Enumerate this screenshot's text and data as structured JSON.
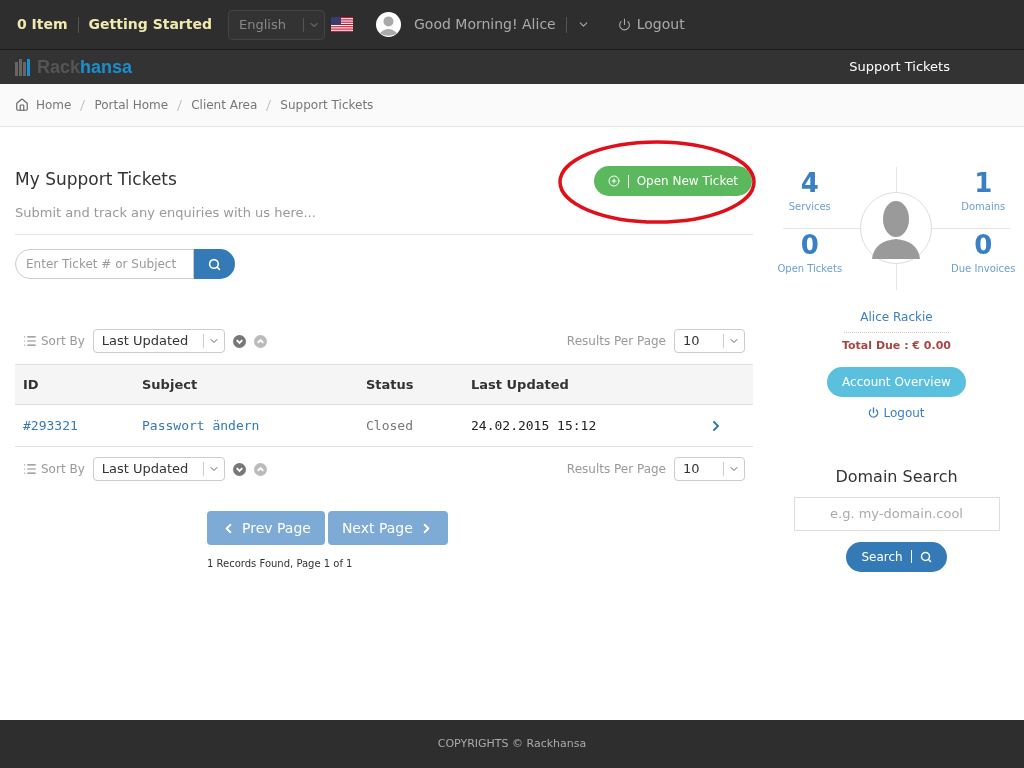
{
  "top_bar": {
    "cart": "0 Item",
    "getting_started": "Getting Started",
    "language": "English",
    "greeting": "Good Morning! Alice",
    "logout": "Logout"
  },
  "nav": {
    "logo_left": "Rack",
    "logo_right": "hansa",
    "active_item": "Support Tickets"
  },
  "breadcrumb": [
    "Home",
    "Portal Home",
    "Client Area",
    "Support Tickets"
  ],
  "page": {
    "title": "My Support Tickets",
    "subtitle": "Submit and track any enquiries with us here...",
    "open_button": "Open New Ticket",
    "search_placeholder": "Enter Ticket # or Subject"
  },
  "sort_bars": [
    {
      "sort_label": "Sort By",
      "sort_value": "Last Updated",
      "per_page_label": "Results Per Page",
      "per_page_value": "10"
    },
    {
      "sort_label": "Sort By",
      "sort_value": "Last Updated",
      "per_page_label": "Results Per Page",
      "per_page_value": "10"
    }
  ],
  "table": {
    "columns": [
      "ID",
      "Subject",
      "Status",
      "Last Updated"
    ],
    "rows": [
      {
        "id": "#293321",
        "subject": "Passwort ändern",
        "status": "Closed",
        "last_updated": "24.02.2015 15:12"
      }
    ]
  },
  "pagination": {
    "prev": {
      "label": "Prev Page",
      "disabled": true
    },
    "next": {
      "label": "Next Page",
      "disabled": true
    },
    "summary": "1 Records Found, Page 1 of 1"
  },
  "sidebar": {
    "stats": [
      {
        "value": "4",
        "label": "Services"
      },
      {
        "value": "1",
        "label": "Domains"
      },
      {
        "value": "0",
        "label": "Open Tickets"
      },
      {
        "value": "0",
        "label": "Due Invoices"
      }
    ],
    "name": "Alice Rackie",
    "total_due": "Total Due : € 0.00",
    "account_button": "Account Overview",
    "logout": "Logout",
    "domain_search": {
      "title": "Domain Search",
      "placeholder": "e.g. my-domain.cool",
      "button": "Search"
    }
  },
  "footer": "COPYRIGHTS © Rackhansa"
}
